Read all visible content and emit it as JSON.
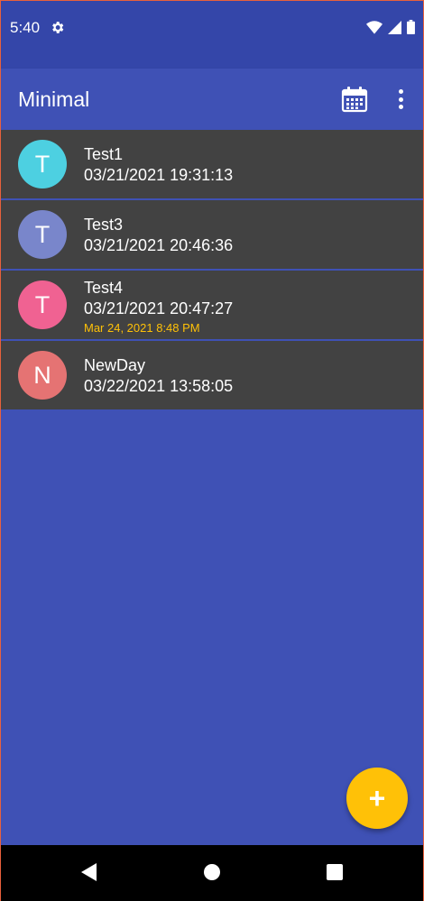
{
  "status_bar": {
    "time": "5:40",
    "icons": [
      "settings-icon",
      "wifi-icon",
      "signal-icon",
      "battery-icon"
    ]
  },
  "app_bar": {
    "title": "Minimal",
    "actions": [
      "calendar-icon",
      "more-vert-icon"
    ]
  },
  "entries": [
    {
      "initial": "T",
      "name": "Test1",
      "timestamp": "03/21/2021 19:31:13",
      "reminder": "",
      "avatar_color": "#4dd0e1"
    },
    {
      "initial": "T",
      "name": "Test3",
      "timestamp": "03/21/2021 20:46:36",
      "reminder": "",
      "avatar_color": "#7986cb"
    },
    {
      "initial": "T",
      "name": "Test4",
      "timestamp": "03/21/2021 20:47:27",
      "reminder": "Mar 24, 2021  8:48 PM",
      "avatar_color": "#f06292"
    },
    {
      "initial": "N",
      "name": "NewDay",
      "timestamp": "03/22/2021 13:58:05",
      "reminder": "",
      "avatar_color": "#e57373"
    }
  ],
  "fab": {
    "icon": "add-icon",
    "label": "+"
  },
  "colors": {
    "primary": "#3f51b5",
    "status_bar": "#3446a9",
    "item_background": "#424242",
    "accent": "#ffc107"
  },
  "nav_bar": {
    "icons": [
      "back-icon",
      "home-icon",
      "recents-icon"
    ]
  }
}
